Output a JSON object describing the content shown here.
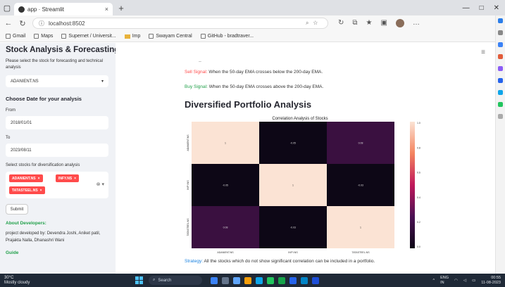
{
  "browser": {
    "tab_title": "app · Streamlit",
    "tab_close": "×",
    "new_tab": "+",
    "window_controls": [
      "—",
      "□",
      "✕"
    ],
    "url": "localhost:8502",
    "bookmarks": [
      "Gmail",
      "Maps",
      "Supernet / Universit...",
      "Imp",
      "Swayam Central",
      "GitHub - bradtraver..."
    ]
  },
  "sidebar": {
    "title": "Stock Analysis & Forecasting",
    "instruction": "Please select the stock for forecasting and technical analysis",
    "stock_select_value": "ADANIENT.NS",
    "date_heading": "Choose Date for your analysis",
    "from_label": "From",
    "from_value": "2018/01/01",
    "to_label": "To",
    "to_value": "2023/08/11",
    "diversification_label": "Select stocks for diversification analysis",
    "selected_stocks": [
      "ADANIENT.NS",
      "INFY.NS",
      "TATASTEEL.NS"
    ],
    "submit_label": "Submit",
    "about_link": "About Developers:",
    "developers_text": "project developed by: Devendra Joshi, Aniket patil, Prajakta Nalla, Dhanashri Wani",
    "footer_link": "Guide"
  },
  "main": {
    "sell_label": "Sell Signal:",
    "sell_text": " When the 50-day EMA crosses below the 200-day EMA.",
    "buy_label": "Buy Signal:",
    "buy_text": " When the 50-day EMA crosses above the 200-day EMA.",
    "section_title": "Diversified Portfolio Analysis",
    "strategy_label": "Strategy:",
    "strategy_text": " All the stocks which do not show significant correlation can be included in a portfolio."
  },
  "chart_data": {
    "type": "heatmap",
    "title": "Correlation Analysis of Stocks",
    "labels": [
      "ADANIENT.NS",
      "INFY.NS",
      "TATASTEEL.NS"
    ],
    "matrix": [
      [
        1,
        -0.05,
        0.08
      ],
      [
        -0.05,
        1,
        -0.03
      ],
      [
        0.08,
        -0.03,
        1
      ]
    ],
    "colorbar_ticks": [
      "1.0",
      "0.8",
      "0.6",
      "0.4",
      "0.2",
      "0.0"
    ],
    "colors": {
      "high": "#fbe3d4",
      "low": "#0d0716",
      "mid": "#3a1040"
    }
  },
  "taskbar": {
    "weather_temp": "30°C",
    "weather_desc": "Mostly cloudy",
    "search_placeholder": "Search",
    "language": "ENG",
    "region": "IN",
    "time": "00:55",
    "date": "11-08-2023"
  }
}
